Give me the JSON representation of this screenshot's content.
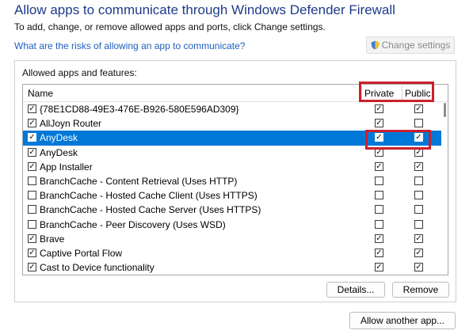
{
  "header": {
    "title": "Allow apps to communicate through Windows Defender Firewall",
    "subtitle": "To add, change, or remove allowed apps and ports, click Change settings.",
    "risk_link": "What are the risks of allowing an app to communicate?",
    "change_settings_label": "Change settings"
  },
  "allowed": {
    "group_label": "Allowed apps and features:",
    "columns": {
      "name": "Name",
      "private": "Private",
      "public": "Public"
    },
    "rows": [
      {
        "name": "{78E1CD88-49E3-476E-B926-580E596AD309}",
        "enabled": true,
        "private": true,
        "public": true,
        "selected": false
      },
      {
        "name": "AllJoyn Router",
        "enabled": true,
        "private": true,
        "public": false,
        "selected": false
      },
      {
        "name": "AnyDesk",
        "enabled": true,
        "private": true,
        "public": true,
        "selected": true
      },
      {
        "name": "AnyDesk",
        "enabled": true,
        "private": true,
        "public": true,
        "selected": false
      },
      {
        "name": "App Installer",
        "enabled": true,
        "private": true,
        "public": true,
        "selected": false
      },
      {
        "name": "BranchCache - Content Retrieval (Uses HTTP)",
        "enabled": false,
        "private": false,
        "public": false,
        "selected": false
      },
      {
        "name": "BranchCache - Hosted Cache Client (Uses HTTPS)",
        "enabled": false,
        "private": false,
        "public": false,
        "selected": false
      },
      {
        "name": "BranchCache - Hosted Cache Server (Uses HTTPS)",
        "enabled": false,
        "private": false,
        "public": false,
        "selected": false
      },
      {
        "name": "BranchCache - Peer Discovery (Uses WSD)",
        "enabled": false,
        "private": false,
        "public": false,
        "selected": false
      },
      {
        "name": "Brave",
        "enabled": true,
        "private": true,
        "public": true,
        "selected": false
      },
      {
        "name": "Captive Portal Flow",
        "enabled": true,
        "private": true,
        "public": true,
        "selected": false
      },
      {
        "name": "Cast to Device functionality",
        "enabled": true,
        "private": true,
        "public": true,
        "selected": false
      }
    ]
  },
  "buttons": {
    "details": "Details...",
    "remove": "Remove",
    "allow_another": "Allow another app..."
  },
  "colors": {
    "title": "#1e3a8a",
    "link": "#1f5fbf",
    "selection": "#0078d7",
    "highlight": "#cc1f2d"
  }
}
